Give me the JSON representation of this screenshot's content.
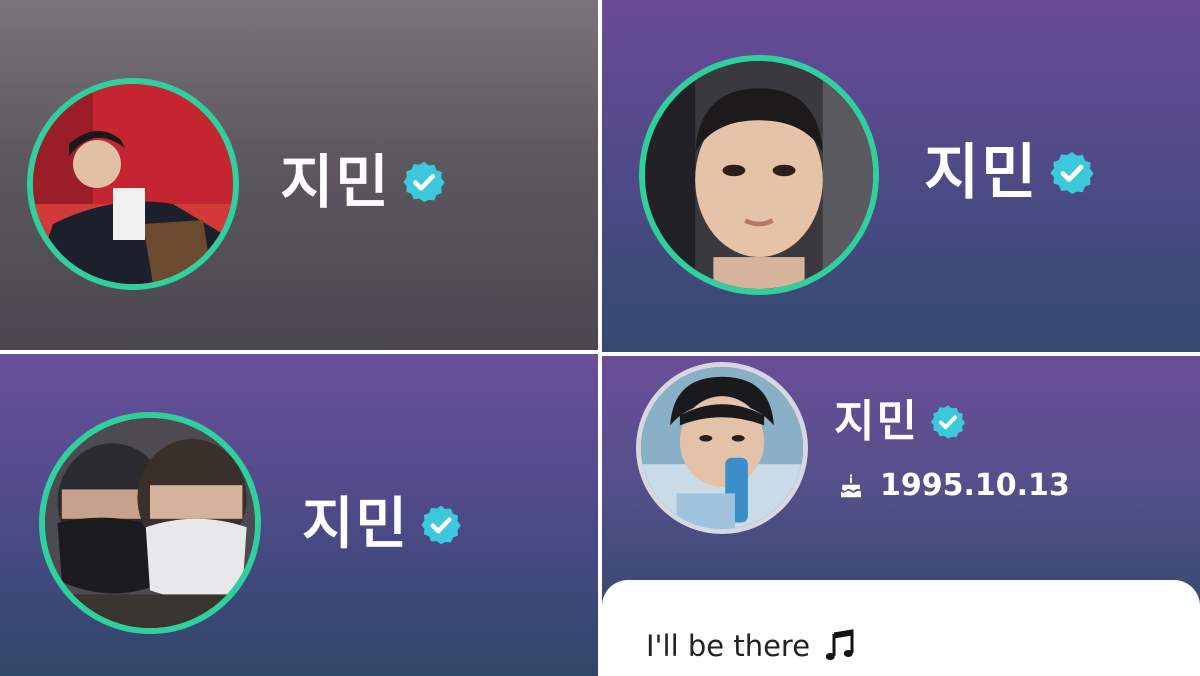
{
  "profiles": [
    {
      "name": "지민",
      "verified": true,
      "avatar_ring_color": "#2fcf9e"
    },
    {
      "name": "지민",
      "verified": true,
      "avatar_ring_color": "#2fcf9e"
    },
    {
      "name": "지민",
      "verified": true,
      "avatar_ring_color": "#2fcf9e"
    },
    {
      "name": "지민",
      "verified": true,
      "avatar_ring_color": "#d7d7e0",
      "birthday": "1995.10.13",
      "status_message": "I'll be there"
    }
  ],
  "colors": {
    "verified_badge": "#3dc9dc",
    "name_text": "#ffffff",
    "card_background": "#ffffff"
  },
  "icons": {
    "verified": "verified-badge-icon",
    "birthday": "birthday-cake-icon",
    "status": "music-note-icon"
  }
}
